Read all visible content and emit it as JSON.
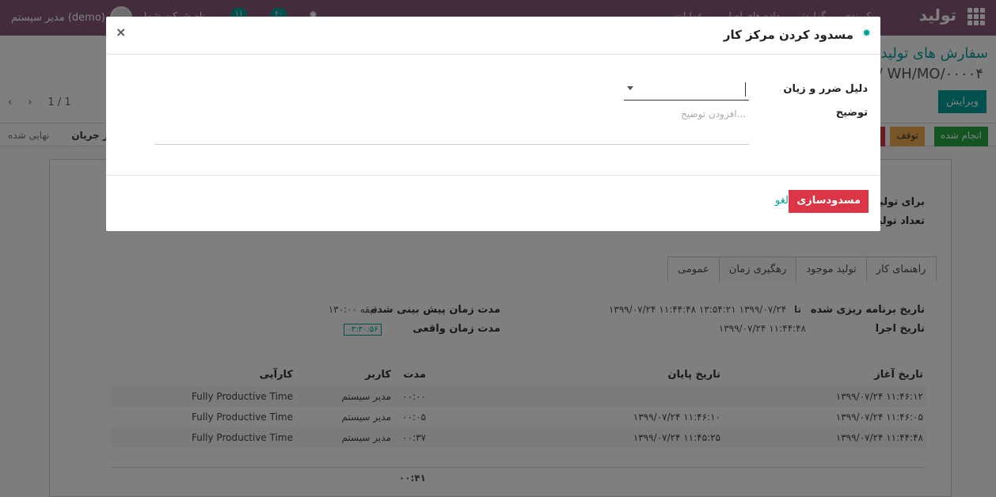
{
  "topbar": {
    "brand": "تولید",
    "menu": [
      "عملیات",
      "داده های اصلی",
      "گزارش",
      "پیکربندی"
    ],
    "company_label": "نام شرکت شما",
    "user": "مدیر سیستم (demo)",
    "badge_messages": "۱۱",
    "badge_activities": "۲۰"
  },
  "breadcrumb": {
    "parent": "سفارش های تولید",
    "current": "/ WH/MO/۰۰۰۰۴"
  },
  "control": {
    "edit_label": "ویرایش",
    "pager": "1 / 1"
  },
  "status": {
    "done_label": "انجام شده",
    "pause_label": "توقف",
    "stages": [
      "در جریان",
      "نهایی شده"
    ]
  },
  "form": {
    "to_produce_label": "برای تولید",
    "qty_produced_label": "تعداد تولید"
  },
  "tabs": [
    "راهنمای کار",
    "تولید موجود",
    "رهگیری زمان",
    "عمومی"
  ],
  "active_tab": "رهگیری زمان",
  "time": {
    "planned_label": "تاریخ برنامه ریزی شده",
    "planned_start": "۱۳۹۹/۰۷/۲۴ ۱۱:۴۴:۴۸",
    "planned_to": "تا",
    "planned_end": "۱۳۹۹/۰۷/۲۴ ۱۳:۵۴:۲۱",
    "exec_label": "تاریخ اجرا",
    "exec_value": "۱۳۹۹/۰۷/۲۴ ۱۱:۴۴:۴۸",
    "expected_label": "مدت زمان پیش بینی شده",
    "expected_value": "۱۳۰:۰۰ دقیقه",
    "real_label": "مدت زمان واقعی",
    "real_value": "۰۳:۳۰:۵۶"
  },
  "table": {
    "headers": {
      "start": "تاریخ آغاز",
      "end": "تاریخ پایان",
      "duration": "مدت",
      "user": "کاربر",
      "efficiency": "کارآیی"
    },
    "rows": [
      {
        "start": "۱۳۹۹/۰۷/۲۴ ۱۱:۴۶:۱۲",
        "end": "",
        "duration": "۰۰:۰۰",
        "user": "مدیر سیستم",
        "efficiency": "Fully Productive Time"
      },
      {
        "start": "۱۳۹۹/۰۷/۲۴ ۱۱:۴۶:۰۵",
        "end": "۱۳۹۹/۰۷/۲۴ ۱۱:۴۶:۱۰",
        "duration": "۰۰:۰۵",
        "user": "مدیر سیستم",
        "efficiency": "Fully Productive Time"
      },
      {
        "start": "۱۳۹۹/۰۷/۲۴ ۱۱:۴۴:۴۸",
        "end": "۱۳۹۹/۰۷/۲۴ ۱۱:۴۵:۲۵",
        "duration": "۰۰:۳۷",
        "user": "مدیر سیستم",
        "efficiency": "Fully Productive Time"
      }
    ],
    "total": "۰۰:۴۱"
  },
  "modal": {
    "title": "مسدود کردن مرکز کار",
    "close": "×",
    "reason_label": "دلیل ضرر و زیان",
    "desc_label": "توضیح",
    "desc_placeholder": "افزودن توضیح...",
    "block_label": "مسدودسازی",
    "cancel_label": "لغو"
  },
  "colors": {
    "primary": "#875a7b",
    "accent": "#00a09d",
    "danger": "#dc3545",
    "done": "#28a745",
    "pause": "#f0ad4e"
  }
}
